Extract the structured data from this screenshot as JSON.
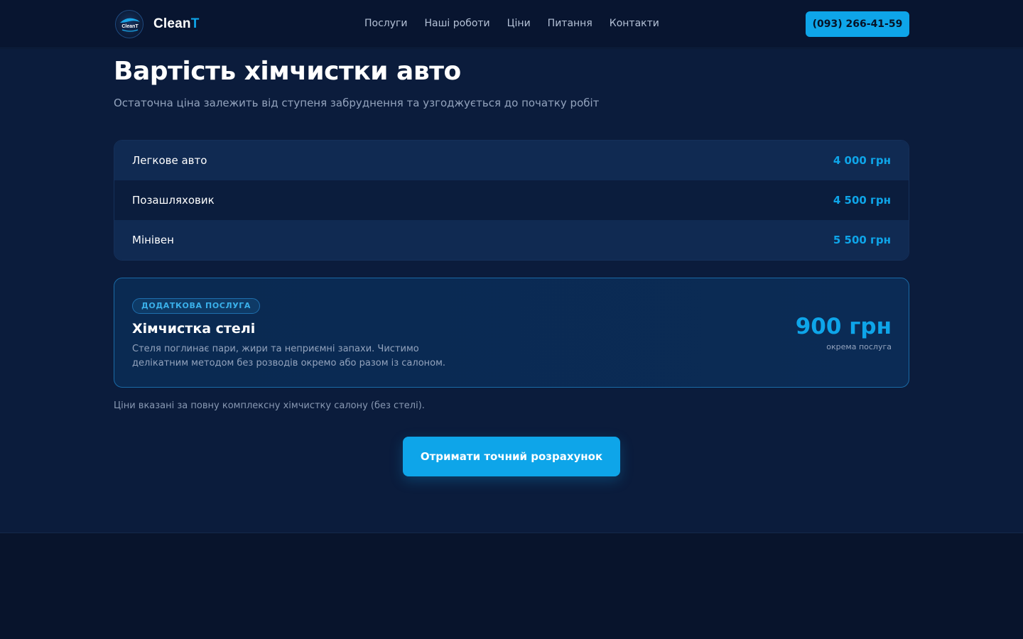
{
  "header": {
    "logo": {
      "badge_text": "CleanT",
      "name_main": "Clean",
      "name_accent": "T"
    },
    "nav": [
      {
        "label": "Послуги"
      },
      {
        "label": "Наші роботи"
      },
      {
        "label": "Ціни"
      },
      {
        "label": "Питання"
      },
      {
        "label": "Контакти"
      }
    ],
    "phone": "(093) 266-41-59"
  },
  "main": {
    "title": "Вартість хімчистки авто",
    "subtitle": "Остаточна ціна залежить від ступеня забруднення та узгоджується до початку робіт",
    "prices": [
      {
        "name": "Легкове авто",
        "value": "4 000 грн"
      },
      {
        "name": "Позашляховик",
        "value": "4 500 грн"
      },
      {
        "name": "Мінівен",
        "value": "5 500 грн"
      }
    ],
    "extra": {
      "badge": "ДОДАТКОВА ПОСЛУГА",
      "title": "Хімчистка стелі",
      "description": "Стеля поглинає пари, жири та неприємні запахи. Чистимо делікатним методом без розводів окремо або разом із салоном.",
      "price": "900 грн",
      "note": "окрема послуга"
    },
    "footnote": "Ціни вказані за повну комплексну хімчистку салону (без стелі).",
    "cta": "Отримати точний розрахунок"
  },
  "colors": {
    "accent": "#0ea5e9",
    "background": "#0b1c3c",
    "header_bg": "#081530"
  }
}
